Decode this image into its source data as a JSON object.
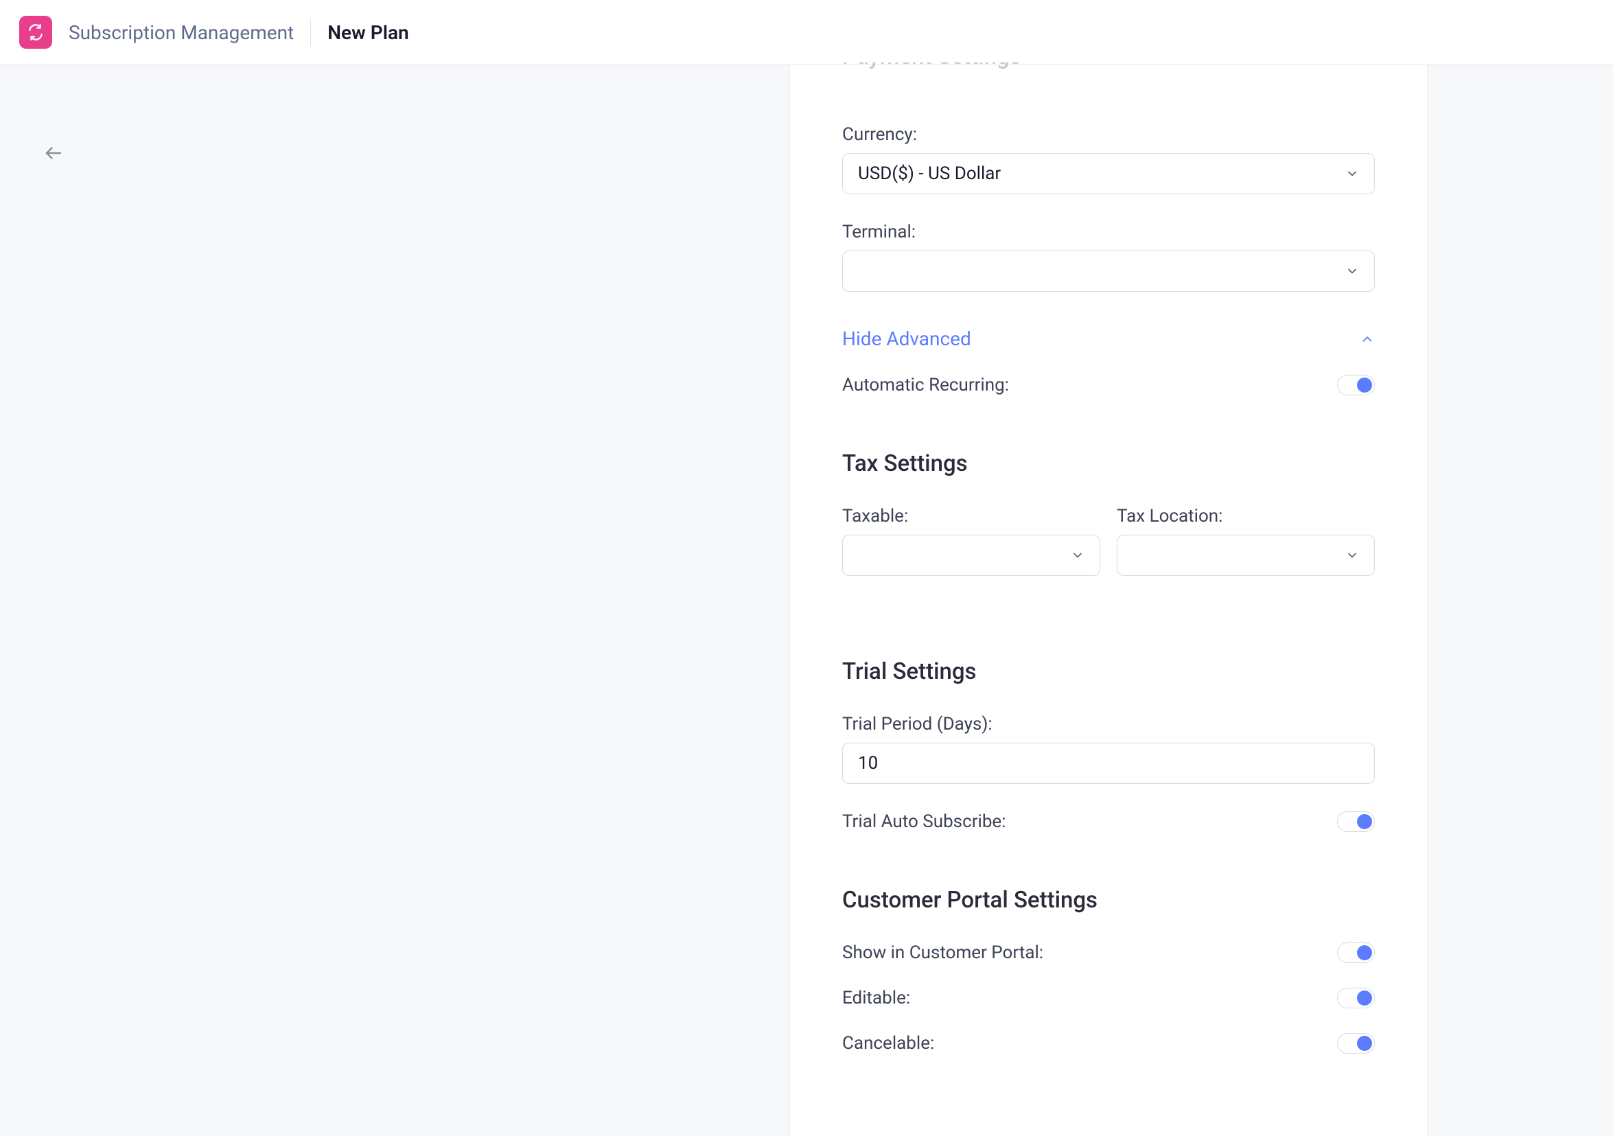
{
  "header": {
    "breadcrumb_parent": "Subscription Management",
    "breadcrumb_current": "New Plan"
  },
  "payment": {
    "section_title": "Payment Settings",
    "currency_label": "Currency:",
    "currency_value": "USD($) - US Dollar",
    "terminal_label": "Terminal:",
    "terminal_value": "",
    "toggle_link": "Hide Advanced",
    "auto_recurring_label": "Automatic Recurring:",
    "auto_recurring": true
  },
  "tax": {
    "section_title": "Tax Settings",
    "taxable_label": "Taxable:",
    "taxable_value": "",
    "location_label": "Tax Location:",
    "location_value": ""
  },
  "trial": {
    "section_title": "Trial Settings",
    "period_label": "Trial Period (Days):",
    "period_value": "10",
    "auto_subscribe_label": "Trial Auto Subscribe:",
    "auto_subscribe": true
  },
  "portal": {
    "section_title": "Customer Portal Settings",
    "show_label": "Show in Customer Portal:",
    "show": true,
    "editable_label": "Editable:",
    "editable": true,
    "cancelable_label": "Cancelable:",
    "cancelable": true
  }
}
